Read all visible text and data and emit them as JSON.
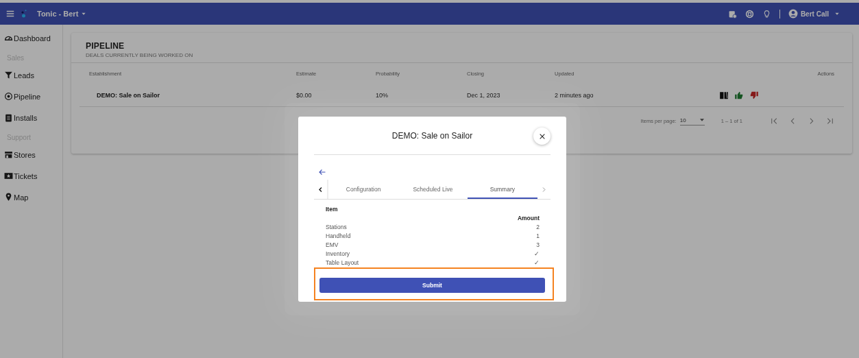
{
  "top_bar": {
    "title": "Tonic - Bert",
    "user": "Bert Call"
  },
  "sidebar": {
    "items": [
      {
        "kind": "link",
        "label": "Dashboard"
      },
      {
        "kind": "heading",
        "label": "Sales"
      },
      {
        "kind": "link",
        "label": "Leads"
      },
      {
        "kind": "link",
        "label": "Pipeline"
      },
      {
        "kind": "link",
        "label": "Installs"
      },
      {
        "kind": "heading",
        "label": "Support"
      },
      {
        "kind": "link",
        "label": "Stores"
      },
      {
        "kind": "link",
        "label": "Tickets"
      },
      {
        "kind": "link",
        "label": "Map"
      }
    ]
  },
  "card": {
    "title": "PIPELINE",
    "subtitle": "DEALS CURRENTLY BEING WORKED ON",
    "table": {
      "columns": [
        "Establishment",
        "Estimate",
        "Probability",
        "Closing",
        "Updated",
        "Actions"
      ],
      "rows": [
        {
          "establishment": "DEMO: Sale on Sailor",
          "estimate": "$0.00",
          "probability": "10%",
          "closing": "Dec 1, 2023",
          "updated": "2 minutes ago"
        }
      ]
    },
    "paginator": {
      "label": "Items per page:",
      "page_size": "10",
      "range": "1 – 1 of 1"
    }
  },
  "dialog": {
    "title": "DEMO: Sale on Sailor",
    "tabs": [
      {
        "label": "Configuration",
        "selected": false
      },
      {
        "label": "Scheduled Live",
        "selected": false
      },
      {
        "label": "Summary",
        "selected": true
      }
    ],
    "summary": {
      "columns": [
        "Item",
        "Amount"
      ],
      "rows": [
        {
          "item": "Stations",
          "amount": "2"
        },
        {
          "item": "Handheld",
          "amount": "1"
        },
        {
          "item": "EMV",
          "amount": "3"
        },
        {
          "item": "Inventory",
          "amount": "✓"
        },
        {
          "item": "Table Layout",
          "amount": "✓"
        }
      ]
    },
    "submit": "Submit"
  }
}
